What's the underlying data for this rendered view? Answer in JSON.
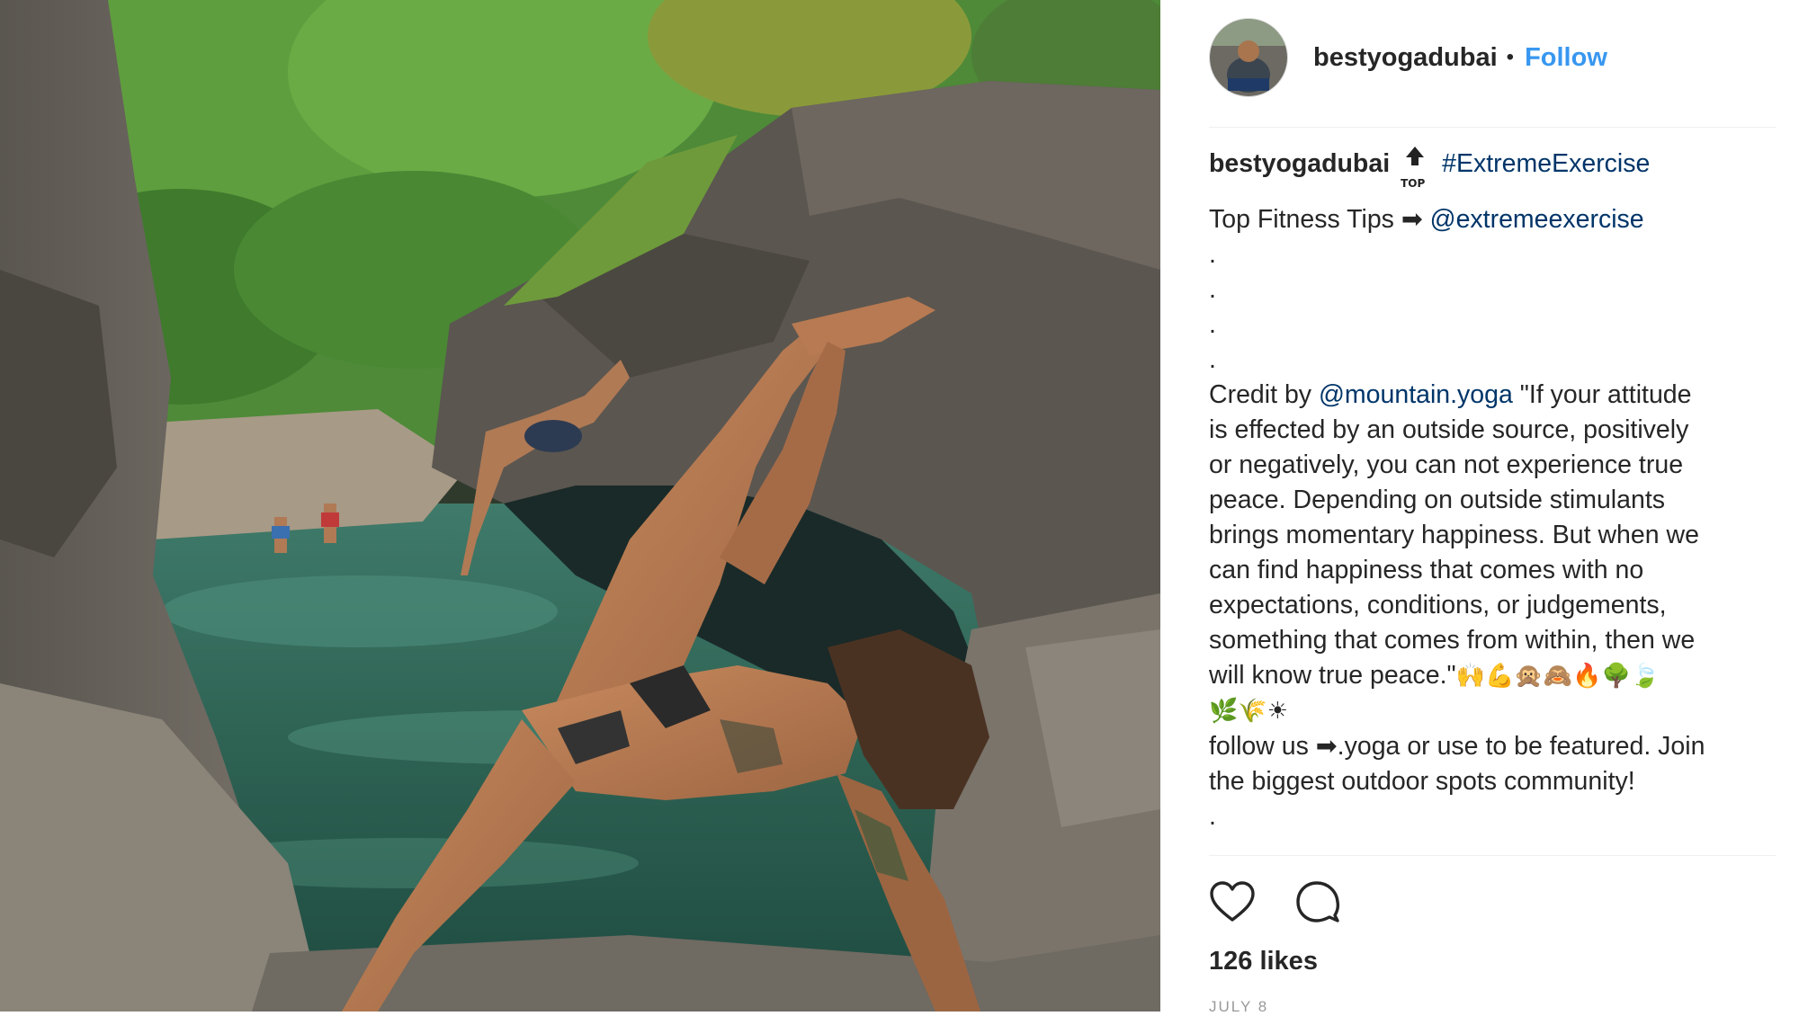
{
  "post": {
    "username": "bestyogadubai",
    "separator": "•",
    "follow_label": "Follow",
    "badge_text": "TOP",
    "caption": {
      "hashtag": "#ExtremeExercise",
      "line1_text": "Top Fitness Tips ➡",
      "line1_mention": "@extremeexercise",
      "dots": [
        ".",
        ".",
        ".",
        "."
      ],
      "credit_prefix": "Credit by",
      "credit_mention": "@mountain.yoga",
      "quote_lines": [
        " \"If your attitude",
        "is effected by an outside source, positively",
        "or negatively, you can not experience true",
        "peace. Depending on outside stimulants",
        "brings momentary happiness. But when we",
        "can find happiness that comes with no",
        "expectations, conditions, or judgements,",
        "something that comes from within, then we",
        "will know true peace.\""
      ],
      "emoji_row1": "🙌💪🙊🙈🔥🌳🍃",
      "emoji_row2": "🌿🌾☀",
      "follow_lines": [
        "follow us ➡.yoga or use to be featured. Join",
        "the biggest outdoor spots community!"
      ],
      "trailing_dot": "."
    },
    "likes": "126 likes",
    "date": "JULY 8"
  },
  "icons": {
    "like": "heart-icon",
    "comment": "comment-icon"
  },
  "colors": {
    "link_blue": "#003569",
    "follow_blue": "#3897f0",
    "text": "#262626",
    "muted": "#999999"
  }
}
